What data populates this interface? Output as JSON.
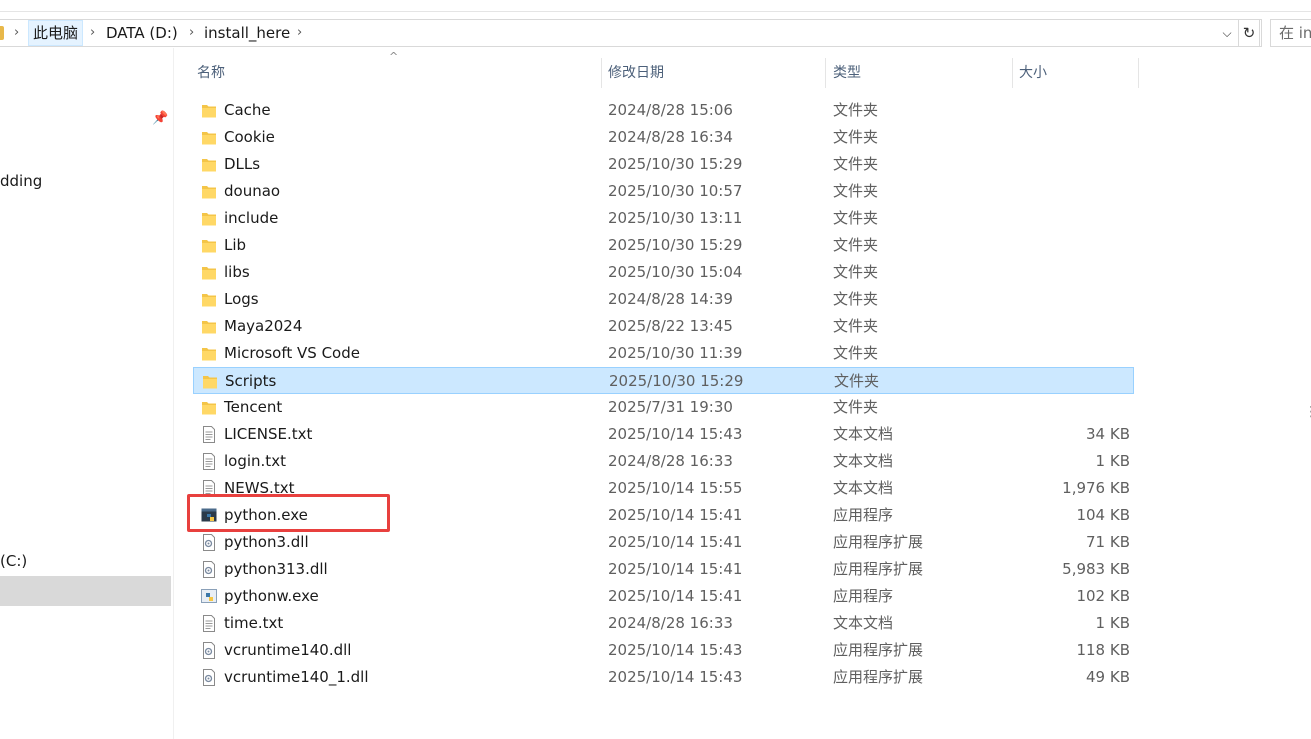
{
  "address": {
    "crumbs": [
      "此电脑",
      "DATA (D:)",
      "install_here"
    ],
    "search_placeholder": "在 in"
  },
  "nav": {
    "items": [
      "dding",
      "(C:)"
    ]
  },
  "columns": {
    "name": "名称",
    "date": "修改日期",
    "type": "类型",
    "size": "大小"
  },
  "files": [
    {
      "name": "Cache",
      "date": "2024/8/28 15:06",
      "type": "文件夹",
      "size": "",
      "icon": "folder-icon"
    },
    {
      "name": "Cookie",
      "date": "2024/8/28 16:34",
      "type": "文件夹",
      "size": "",
      "icon": "folder-icon"
    },
    {
      "name": "DLLs",
      "date": "2025/10/30 15:29",
      "type": "文件夹",
      "size": "",
      "icon": "folder-icon"
    },
    {
      "name": "dounao",
      "date": "2025/10/30 10:57",
      "type": "文件夹",
      "size": "",
      "icon": "folder-icon"
    },
    {
      "name": "include",
      "date": "2025/10/30 13:11",
      "type": "文件夹",
      "size": "",
      "icon": "folder-icon"
    },
    {
      "name": "Lib",
      "date": "2025/10/30 15:29",
      "type": "文件夹",
      "size": "",
      "icon": "folder-icon"
    },
    {
      "name": "libs",
      "date": "2025/10/30 15:04",
      "type": "文件夹",
      "size": "",
      "icon": "folder-icon"
    },
    {
      "name": "Logs",
      "date": "2024/8/28 14:39",
      "type": "文件夹",
      "size": "",
      "icon": "folder-icon"
    },
    {
      "name": "Maya2024",
      "date": "2025/8/22 13:45",
      "type": "文件夹",
      "size": "",
      "icon": "folder-icon"
    },
    {
      "name": "Microsoft VS Code",
      "date": "2025/10/30 11:39",
      "type": "文件夹",
      "size": "",
      "icon": "folder-icon"
    },
    {
      "name": "Scripts",
      "date": "2025/10/30 15:29",
      "type": "文件夹",
      "size": "",
      "icon": "folder-icon",
      "selected": true
    },
    {
      "name": "Tencent",
      "date": "2025/7/31 19:30",
      "type": "文件夹",
      "size": "",
      "icon": "folder-icon"
    },
    {
      "name": "LICENSE.txt",
      "date": "2025/10/14 15:43",
      "type": "文本文档",
      "size": "34 KB",
      "icon": "text-file-icon"
    },
    {
      "name": "login.txt",
      "date": "2024/8/28 16:33",
      "type": "文本文档",
      "size": "1 KB",
      "icon": "text-file-icon"
    },
    {
      "name": "NEWS.txt",
      "date": "2025/10/14 15:55",
      "type": "文本文档",
      "size": "1,976 KB",
      "icon": "text-file-icon"
    },
    {
      "name": "python.exe",
      "date": "2025/10/14 15:41",
      "type": "应用程序",
      "size": "104 KB",
      "icon": "python-exe-icon"
    },
    {
      "name": "python3.dll",
      "date": "2025/10/14 15:41",
      "type": "应用程序扩展",
      "size": "71 KB",
      "icon": "dll-file-icon"
    },
    {
      "name": "python313.dll",
      "date": "2025/10/14 15:41",
      "type": "应用程序扩展",
      "size": "5,983 KB",
      "icon": "dll-file-icon"
    },
    {
      "name": "pythonw.exe",
      "date": "2025/10/14 15:41",
      "type": "应用程序",
      "size": "102 KB",
      "icon": "pythonw-exe-icon"
    },
    {
      "name": "time.txt",
      "date": "2024/8/28 16:33",
      "type": "文本文档",
      "size": "1 KB",
      "icon": "text-file-icon"
    },
    {
      "name": "vcruntime140.dll",
      "date": "2025/10/14 15:43",
      "type": "应用程序扩展",
      "size": "118 KB",
      "icon": "dll-file-icon"
    },
    {
      "name": "vcruntime140_1.dll",
      "date": "2025/10/14 15:43",
      "type": "应用程序扩展",
      "size": "49 KB",
      "icon": "dll-file-icon"
    }
  ],
  "colors": {
    "selection": "#cce8ff",
    "annotation": "#e8403e",
    "folder": "#f4c548"
  }
}
